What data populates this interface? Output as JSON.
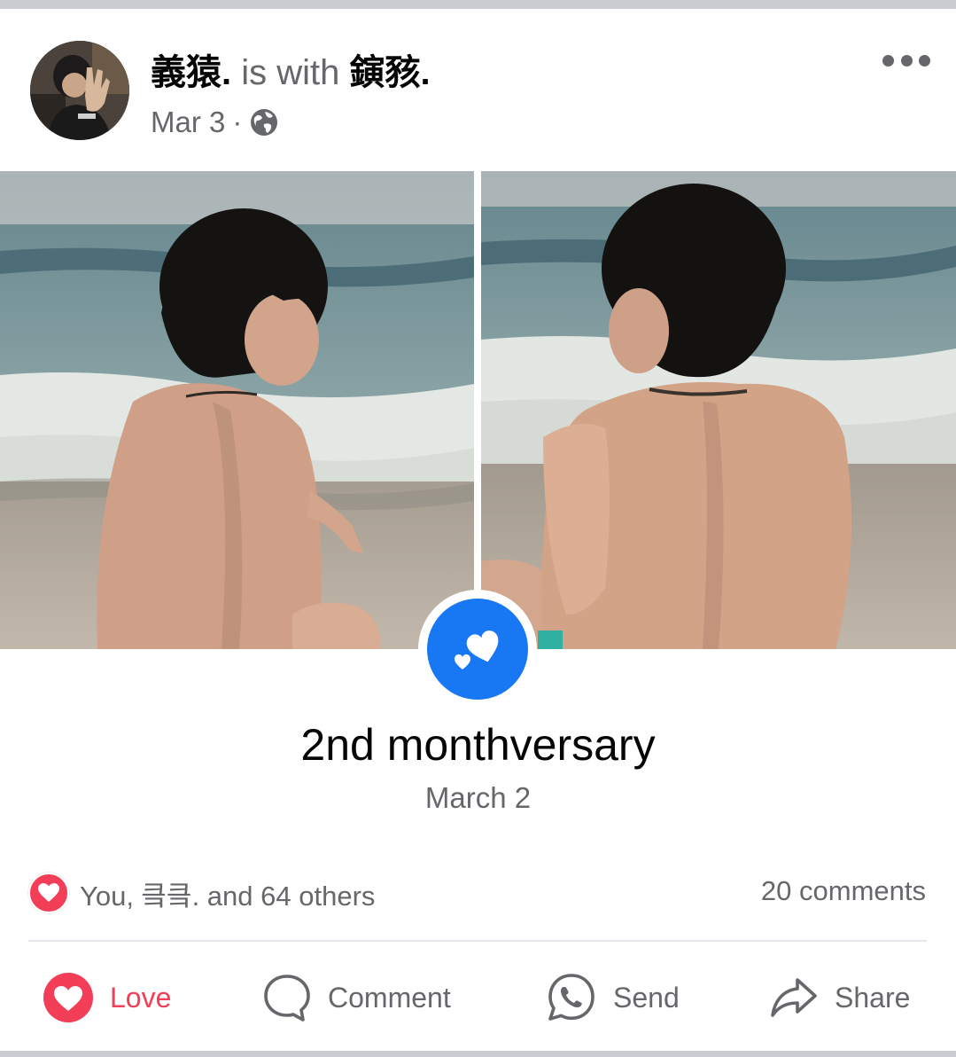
{
  "post": {
    "author": "義猿.",
    "with_text": "is with",
    "tagged": "鏔豥.",
    "date": "Mar 3",
    "separator": "·",
    "privacy_icon": "globe-icon",
    "more_icon": "more-horizontal-icon"
  },
  "event": {
    "icon": "hearts-icon",
    "title": "2nd monthversary",
    "date": "March 2"
  },
  "reactions": {
    "icon": "love-reaction-icon",
    "summary": "You, 킄킄. and 64 others",
    "comments": "20 comments"
  },
  "actions": {
    "love": "Love",
    "comment": "Comment",
    "send": "Send",
    "share": "Share"
  },
  "colors": {
    "love_red": "#f33e58",
    "facebook_blue": "#1877f2",
    "muted_text": "#65676b"
  }
}
